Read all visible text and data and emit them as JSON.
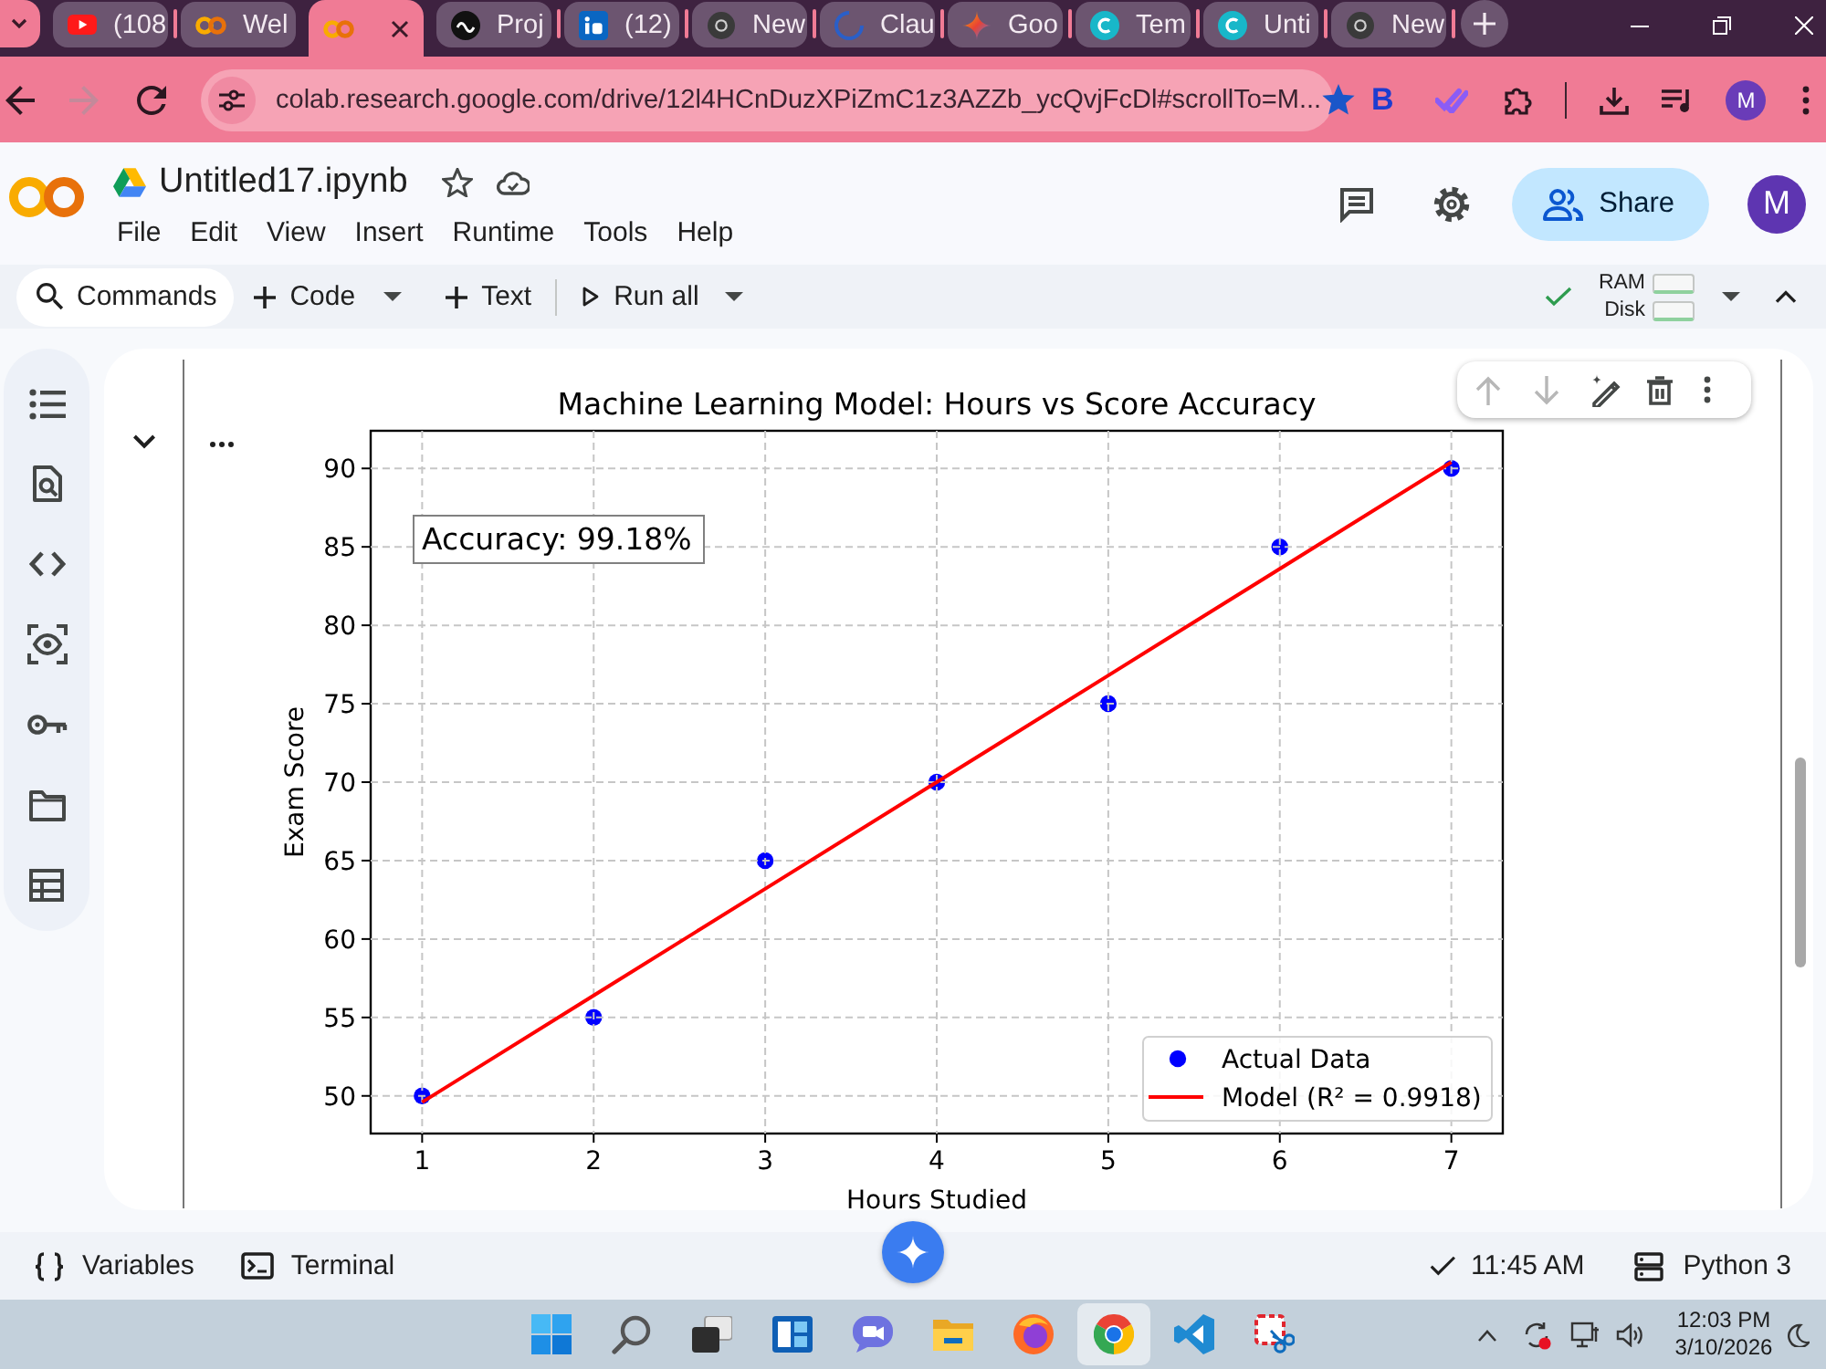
{
  "browser": {
    "tabs": [
      {
        "kind": "play",
        "label": "(108",
        "selected": false
      },
      {
        "kind": "rings",
        "label": "Wel",
        "selected": false
      },
      {
        "kind": "rings",
        "selected": true
      },
      {
        "kind": "disc",
        "label": "Proj",
        "selected": false
      },
      {
        "kind": "square",
        "label": "(12)",
        "selected": false
      },
      {
        "kind": "globe",
        "label": "New",
        "selected": false
      },
      {
        "kind": "arc",
        "label": "Clau",
        "selected": false
      },
      {
        "kind": "sparkle",
        "label": "Goo",
        "selected": false
      },
      {
        "kind": "letter",
        "label": "Tem",
        "selected": false
      },
      {
        "kind": "letter",
        "label": "Unti",
        "selected": false
      },
      {
        "kind": "globe",
        "label": "New",
        "selected": false
      }
    ],
    "nav": [
      {
        "kind": "back",
        "disabled": false
      },
      {
        "kind": "forward",
        "disabled": true
      },
      {
        "kind": "reload",
        "disabled": false
      }
    ],
    "address": "colab.research.google.com/drive/12l4HCnDuzXPiZmC1z3AZZb_ycQvjFcDl#scrollTo=M...",
    "bookmarked": true,
    "extension_label": "B",
    "profile_initial": "M"
  },
  "notebook": {
    "title": "Untitled17.ipynb",
    "starred": false,
    "menu": [
      "File",
      "Edit",
      "View",
      "Insert",
      "Runtime",
      "Tools",
      "Help"
    ],
    "share_label": "Share",
    "avatar_initial": "M"
  },
  "toolbar": {
    "commands_label": "Commands",
    "insert_buttons": [
      "Code",
      "Text"
    ],
    "run_all_label": "Run all",
    "connected": true,
    "resources": [
      {
        "label": "RAM"
      },
      {
        "label": "Disk"
      }
    ]
  },
  "cell": {
    "actions": [
      {
        "kind": "up",
        "disabled": true
      },
      {
        "kind": "down",
        "disabled": true
      },
      {
        "kind": "edit",
        "disabled": false
      },
      {
        "kind": "delete",
        "disabled": false
      },
      {
        "kind": "more",
        "disabled": false
      }
    ],
    "chart_data": {
      "type": "scatter",
      "title": "Machine Learning Model: Hours vs Score Accuracy",
      "xlabel": "Hours Studied",
      "ylabel": "Exam Score",
      "x": [
        1,
        2,
        3,
        4,
        5,
        6,
        7
      ],
      "xlim": [
        0.7,
        7.3
      ],
      "ylim": [
        47.6,
        92.4
      ],
      "xticks": [
        1,
        2,
        3,
        4,
        5,
        6,
        7
      ],
      "yticks": [
        50,
        55,
        60,
        65,
        70,
        75,
        80,
        85,
        90
      ],
      "grid": true,
      "legend": "lower right",
      "series": [
        {
          "name": "Actual Data",
          "type": "scatter",
          "color": "#0000ff",
          "values": [
            50,
            55,
            65,
            70,
            75,
            85,
            90
          ]
        },
        {
          "name": "Model (R² = 0.9918)",
          "type": "line",
          "color": "#ff0000",
          "values": [
            49.6,
            56.4,
            63.2,
            70,
            76.8,
            83.6,
            90.4
          ]
        }
      ],
      "annotations": [
        "Accuracy: 99.18%"
      ]
    }
  },
  "status_bar": {
    "variables_label": "Variables",
    "terminal_label": "Terminal",
    "last_run": "11:45 AM",
    "runtime": "Python 3"
  },
  "taskbar": {
    "apps": [
      {
        "kind": "start",
        "selected": false
      },
      {
        "kind": "search",
        "selected": false
      },
      {
        "kind": "taskview",
        "selected": false
      },
      {
        "kind": "widgets",
        "selected": false
      },
      {
        "kind": "meet",
        "selected": false
      },
      {
        "kind": "files",
        "selected": false
      },
      {
        "kind": "firefox",
        "selected": false
      },
      {
        "kind": "chrome",
        "selected": true
      },
      {
        "kind": "vscode",
        "selected": false
      },
      {
        "kind": "snip",
        "selected": false
      }
    ],
    "time": "12:03 PM",
    "date": "3/10/2026"
  }
}
